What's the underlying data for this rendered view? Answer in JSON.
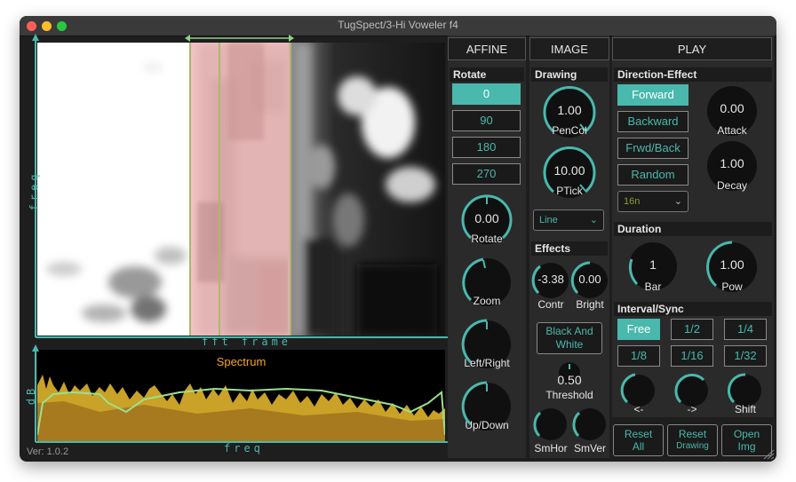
{
  "window": {
    "title": "TugSpect/3-Hi Voweler f4",
    "version": "Ver: 1.0.2"
  },
  "axes": {
    "image_y": "freq",
    "image_x": "fft frame",
    "spec_y": "dB",
    "spec_x": "freq"
  },
  "spectrum": {
    "title": "Spectrum"
  },
  "affine": {
    "header": "AFFINE",
    "rotate_label": "Rotate",
    "rotate_buttons": [
      "0",
      "90",
      "180",
      "270"
    ],
    "knobs": [
      {
        "value": "0.00",
        "label": "Rotate"
      },
      {
        "value": "",
        "label": "Zoom"
      },
      {
        "value": "",
        "label": "Left/Right"
      },
      {
        "value": "",
        "label": "Up/Down"
      }
    ]
  },
  "image": {
    "header": "IMAGE",
    "drawing_label": "Drawing",
    "pencol": {
      "value": "1.00",
      "label": "PenCol"
    },
    "ptick": {
      "value": "10.00",
      "label": "PTick"
    },
    "line_select": "Line",
    "effects_label": "Effects",
    "contr": {
      "value": "-3.38",
      "label": "Contr"
    },
    "bright": {
      "value": "0.00",
      "label": "Bright"
    },
    "bw_button_line1": "Black And",
    "bw_button_line2": "White",
    "threshold": {
      "value": "0.50",
      "label": "Threshold"
    },
    "smhor": {
      "label": "SmHor"
    },
    "smver": {
      "label": "SmVer"
    }
  },
  "play": {
    "header": "PLAY",
    "direction_label": "Direction-Effect",
    "direction_buttons": [
      "Forward",
      "Backward",
      "Frwd/Back",
      "Random"
    ],
    "note_select": "16n",
    "attack": {
      "value": "0.00",
      "label": "Attack"
    },
    "decay": {
      "value": "1.00",
      "label": "Decay"
    },
    "duration_label": "Duration",
    "bar": {
      "value": "1",
      "label": "Bar"
    },
    "pow": {
      "value": "1.00",
      "label": "Pow"
    },
    "interval_label": "Interval/Sync",
    "interval_buttons": [
      "Free",
      "1/2",
      "1/4",
      "1/8",
      "1/16",
      "1/32"
    ],
    "shift_knobs": [
      {
        "label": "<-"
      },
      {
        "label": "->"
      },
      {
        "label": "Shift"
      }
    ]
  },
  "bottom_buttons": [
    {
      "line1": "Reset",
      "line2": "All"
    },
    {
      "line1": "Reset",
      "line2": "Drawing"
    },
    {
      "line1": "Open",
      "line2": "Img"
    }
  ],
  "colors": {
    "accent": "#49b8ad",
    "selection": "#f0b8b8",
    "spectrum_fill": "#c9a227",
    "spectrum_line": "#9be08e",
    "title_orange": "#f5a623"
  }
}
